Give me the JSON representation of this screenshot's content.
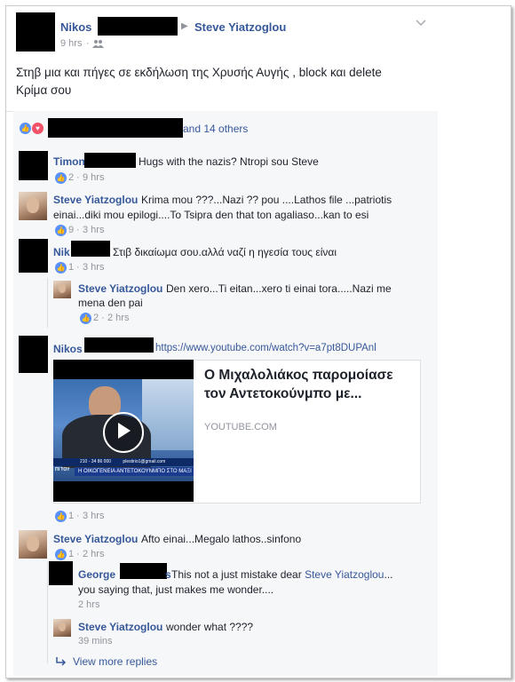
{
  "post": {
    "author": "Nikos",
    "target": "Steve Yiatzoglou",
    "time": "9 hrs",
    "text_line1": "Στηβ μια και πήγες σε εκδήλωση της Χρυσής Αυγής , block και delete",
    "text_line2": "Κρίμα σου",
    "reactions_tail": "and 14 others"
  },
  "comments": [
    {
      "name": "Timon",
      "text": "Hugs with the nazis? Ntropi sou Steve",
      "likes": "2",
      "time": "9 hrs"
    },
    {
      "name": "Steve Yiatzoglou",
      "text_line1": "Krima mou ???...Nazi ?? pou ....Lathos file ...patriotis",
      "text_line2": "einai...diki mou epilogi....To Tsipra den that ton agaliaso...kan to esi",
      "likes": "9",
      "time": "3 hrs"
    },
    {
      "name": "Nik",
      "text": "Στιβ δικαίωμα σου.αλλά ναζί η ηγεσία τους είναι",
      "likes": "1",
      "time": "3 hrs"
    },
    {
      "name": "Steve Yiatzoglou",
      "text_line1": "Den xero...Ti eitan...xero ti einai tora.....Nazi me",
      "text_line2": "mena den pai",
      "likes": "2",
      "time": "2 hrs"
    },
    {
      "name": "Nikos",
      "url": "https://www.youtube.com/watch?v=a7pt8DUPAnl",
      "likes": "1",
      "time": "3 hrs"
    },
    {
      "name": "Steve Yiatzoglou",
      "text": "Afto einai...Megalo lathos..sinfono",
      "likes": "1",
      "time": "2 hrs"
    },
    {
      "name": "George",
      "name_tail": "s",
      "text_pre": "This not a just mistake dear ",
      "mention": "Steve Yiatzoglou",
      "text_post": "...",
      "text_line2": "you saying that, just makes me wonder....",
      "time": "2 hrs"
    },
    {
      "name": "Steve Yiatzoglou",
      "text": "wonder what ????",
      "time": "39 mins"
    }
  ],
  "link_preview": {
    "title_line1": "Ο Μιχαλολιάκος παρομοίασε",
    "title_line2": "τον Αντετοκούνμπο με...",
    "domain": "YOUTUBE.COM",
    "thumb_caption": "Η ΟΙΚΟΓΕΝΕΙΑ ΑΝΤΕΤΟΚΟΥΝΜΠΟ ΣΤΟ ΜΑΞΙ",
    "thumb_ticker": "plestirio1@gmail.com",
    "thumb_phone": "210 - 34 86 000",
    "thumb_logo": "ΠΙ ΤΟΥ"
  },
  "view_more": "View more replies",
  "separator": "·",
  "colors": {
    "accent": "#365899",
    "like": "#5890ff",
    "love": "#f25268",
    "meta": "#90949c"
  }
}
